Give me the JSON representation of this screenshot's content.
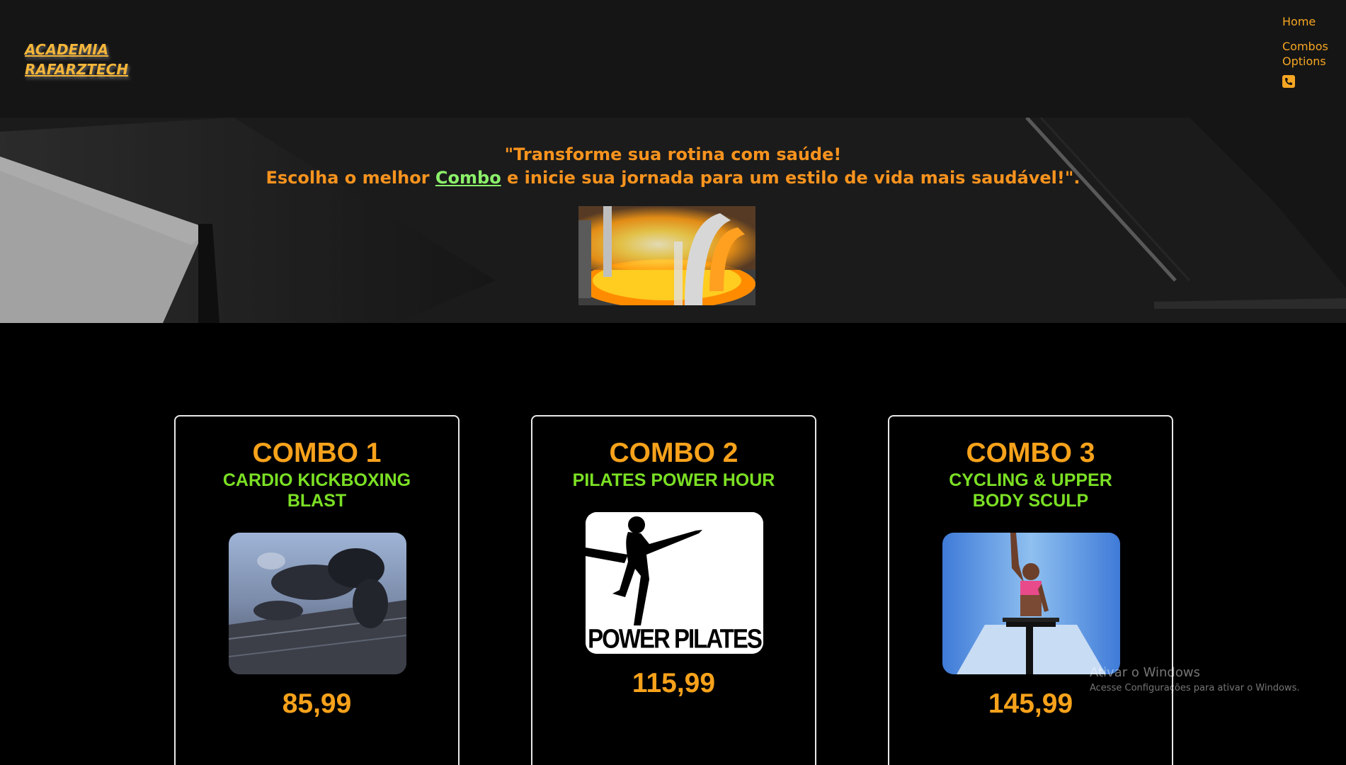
{
  "header": {
    "logo_line1": "ACADEMIA",
    "logo_line2": "RAFARZTECH",
    "nav": {
      "home": "Home",
      "combos": "Combos Options",
      "phone_icon": "phone-icon"
    }
  },
  "hero": {
    "line1": "\"Transforme sua rotina com saúde!",
    "line2_before": "Escolha o melhor ",
    "line2_link": "Combo",
    "line2_after": " e inicie sua jornada para um estilo de vida mais saudável!\"."
  },
  "combos": [
    {
      "title": "COMBO 1",
      "subtitle": "CARDIO KICKBOXING BLAST",
      "price": "85,99"
    },
    {
      "title": "COMBO 2",
      "subtitle": "PILATES POWER HOUR",
      "price": "115,99",
      "image_text": "POWER PILATES"
    },
    {
      "title": "COMBO 3",
      "subtitle": "CYCLING & UPPER BODY SCULP",
      "price": "145,99"
    }
  ],
  "watermark": {
    "title": "Ativar o Windows",
    "subtitle": "Acesse Configurações para ativar o Windows."
  },
  "colors": {
    "accent_orange": "#f7a21b",
    "accent_green": "#7be024",
    "link_green": "#8bf06a",
    "logo_yellow": "#f5b63a"
  }
}
